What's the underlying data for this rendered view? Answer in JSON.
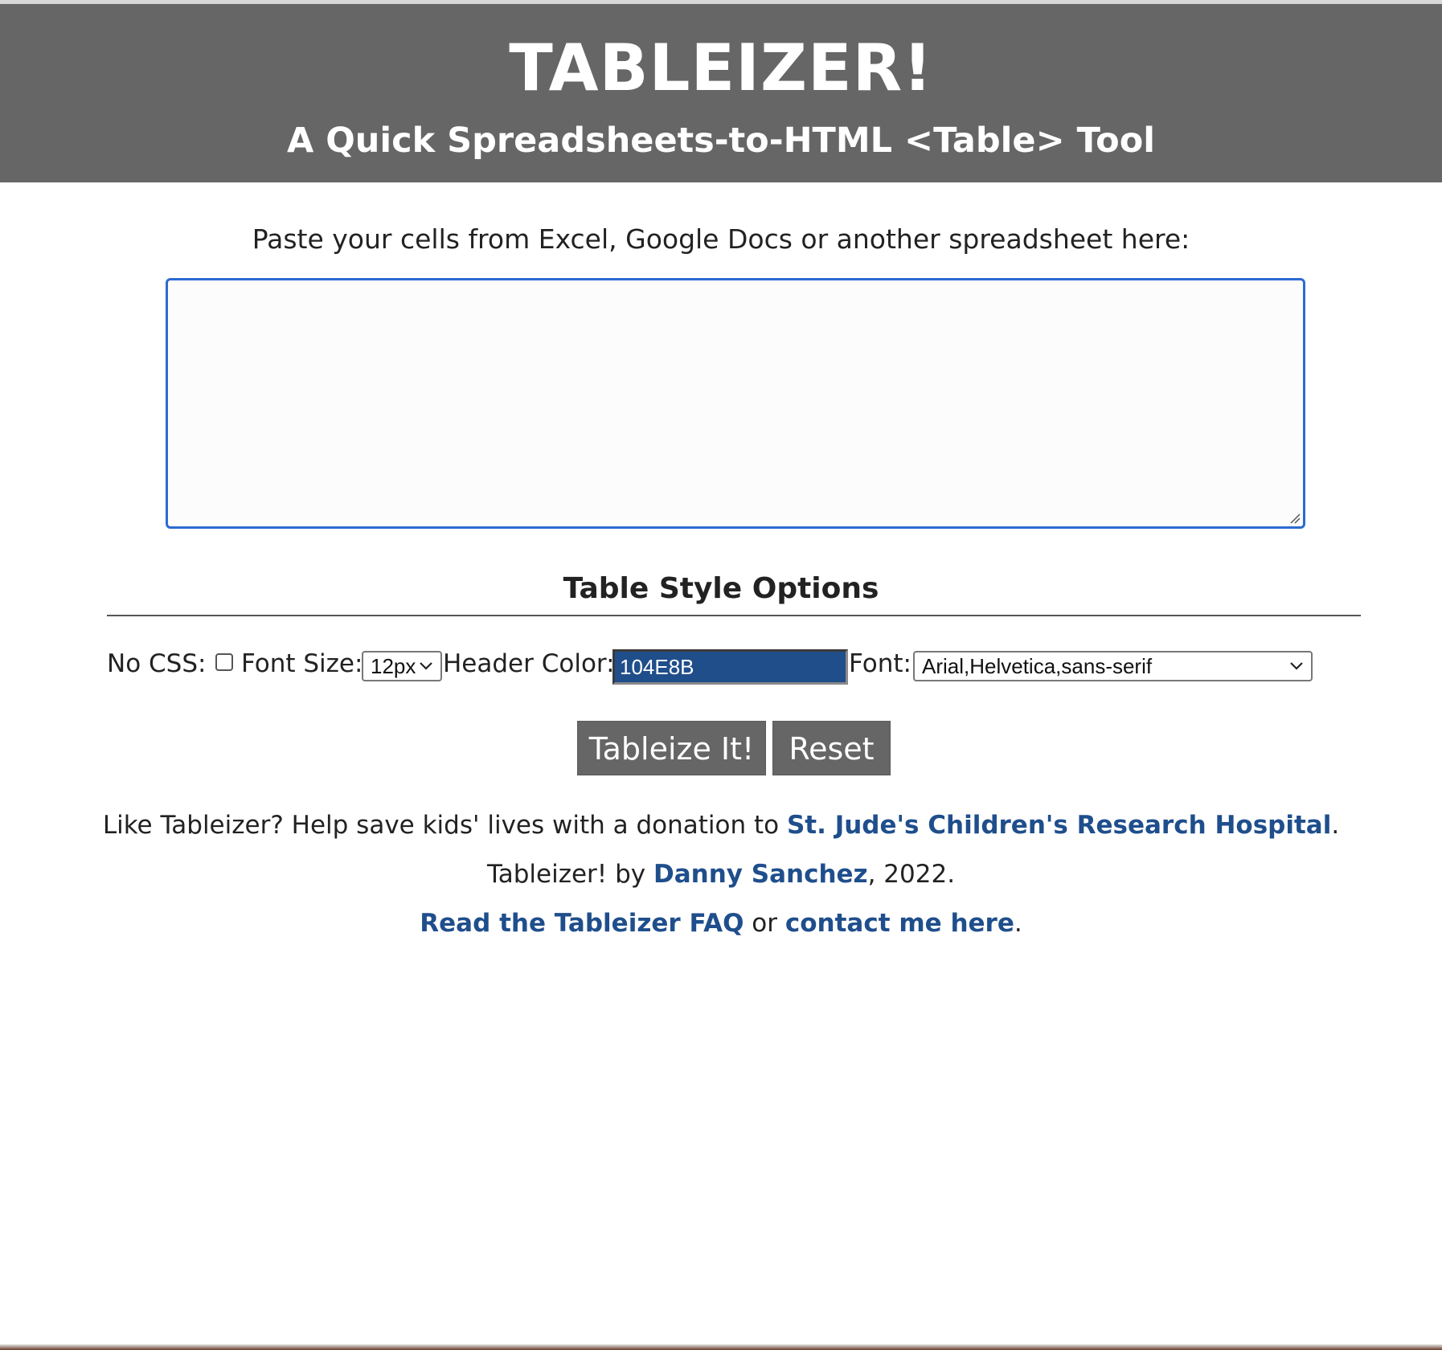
{
  "header": {
    "title": "TABLEIZER!",
    "subtitle": "A Quick Spreadsheets-to-HTML <Table> Tool",
    "background_color": "#666666"
  },
  "paste": {
    "label": "Paste your cells from Excel, Google Docs or another spreadsheet here:",
    "value": "",
    "placeholder": ""
  },
  "options": {
    "title": "Table Style Options",
    "no_css_label": "No CSS:",
    "no_css_checked": false,
    "font_size_label": "Font Size:",
    "font_size_value": "12px",
    "header_color_label": "Header Color:",
    "header_color_value": "104E8B",
    "font_label": "Font:",
    "font_value": "Arial,Helvetica,sans-serif"
  },
  "buttons": {
    "tableize": "Tableize It!",
    "reset": "Reset"
  },
  "footer": {
    "donation_prefix": "Like Tableizer? Help save kids' lives with a donation to ",
    "donation_link": "St. Jude's Children's Research Hospital",
    "donation_suffix": ".",
    "credit_prefix": "Tableizer! by ",
    "credit_link": "Danny Sanchez",
    "credit_suffix": ", 2022.",
    "faq_link": "Read the Tableizer FAQ",
    "faq_or": " or ",
    "contact_link": "contact me here",
    "faq_suffix": "."
  },
  "colors": {
    "link": "#1f4e8c",
    "button": "#666666",
    "focus_border": "#2d6bd1",
    "header_color_swatch": "#204e8b"
  }
}
